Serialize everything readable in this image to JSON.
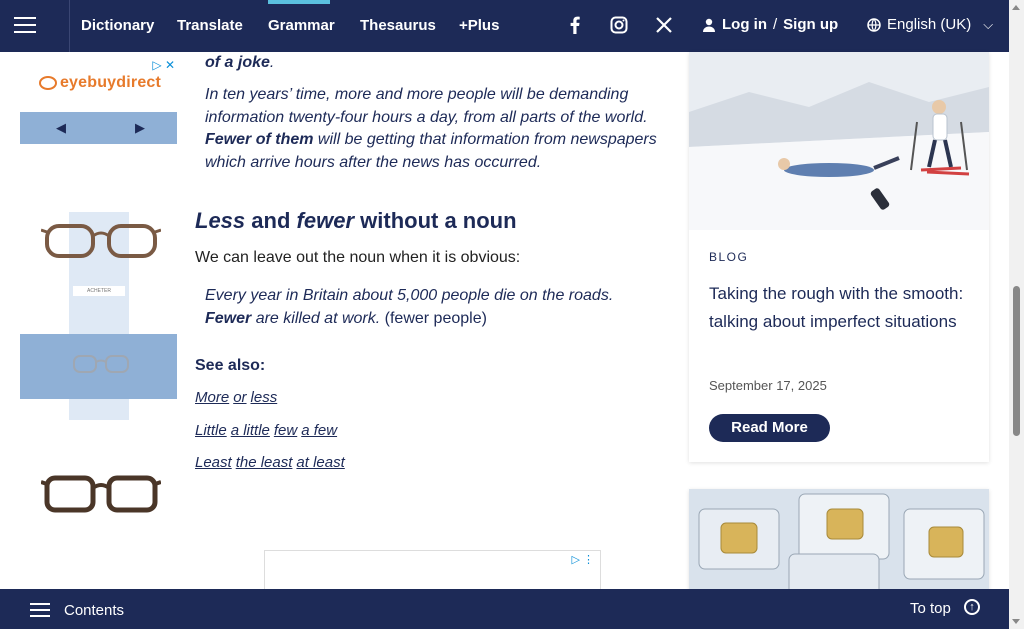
{
  "header": {
    "nav": [
      "Dictionary",
      "Translate",
      "Grammar",
      "Thesaurus",
      "+Plus"
    ],
    "active_nav": "Grammar",
    "social": [
      "facebook-icon",
      "instagram-icon",
      "x-icon"
    ],
    "login": "Log in",
    "signup": "Sign up",
    "login_sep": "/",
    "language": "English (UK)"
  },
  "ad": {
    "brand": "eyebuydirect",
    "panel_text": "ACHETER"
  },
  "article": {
    "example_intro_end": "of a joke",
    "example1": "In ten years’ time, more and more people will be demanding information twenty-four hours a day, from all parts of the world.",
    "example1_bold": "Fewer of them",
    "example1_rest": "will be getting that information from newspapers which arrive hours after the news has occurred.",
    "heading_less": "Less",
    "heading_and": "and",
    "heading_fewer": "fewer",
    "heading_rest": "without a noun",
    "intro": "We can leave out the noun when it is obvious:",
    "example2_line1": "Every year in Britain about 5,000 people die on the roads.",
    "example2_bold": "Fewer",
    "example2_rest": "are killed at work.",
    "example2_note": "(fewer people)",
    "see_also": "See also:",
    "links_row1": [
      "More",
      "or",
      "less"
    ],
    "links_row2": [
      "Little",
      "a little",
      "few",
      "a few"
    ],
    "links_row3": [
      "Least",
      "the least",
      "at least"
    ]
  },
  "sidebar": {
    "label": "BLOG",
    "title": "Taking the rough with the smooth: talking about imperfect situations",
    "date": "September 17, 2025",
    "cta": "Read More"
  },
  "footer": {
    "contents": "Contents",
    "to_top": "To top"
  },
  "colors": {
    "navy": "#1d2a57",
    "accent": "#5bc0de"
  }
}
